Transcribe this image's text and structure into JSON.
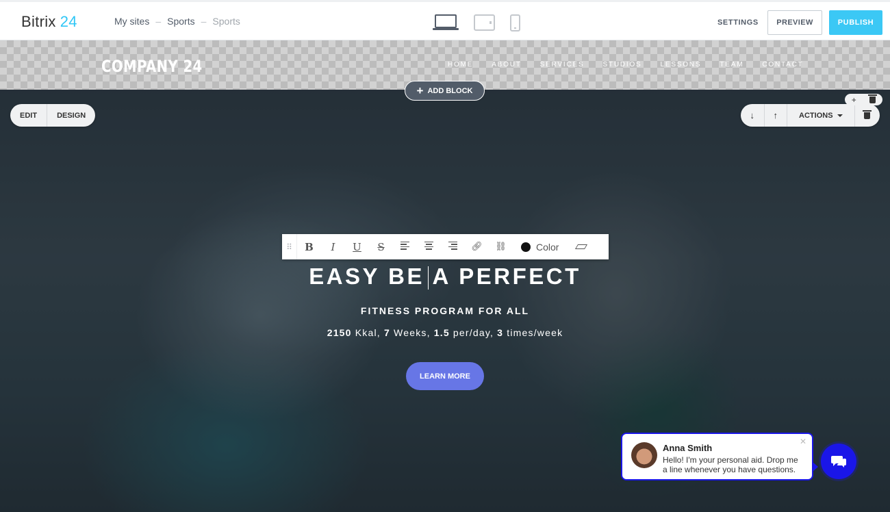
{
  "app": {
    "brand": "Bitrix",
    "brand_num": "24"
  },
  "breadcrumb": [
    "My sites",
    "Sports",
    "Sports"
  ],
  "device_icons": [
    "laptop-icon",
    "tablet-icon",
    "phone-icon"
  ],
  "toolbar": {
    "settings_label": "SETTINGS",
    "preview_label": "PREVIEW",
    "publish_label": "PUBLISH"
  },
  "site": {
    "company": "COMPANY 24",
    "nav": [
      "HOME",
      "ABOUT",
      "SERVICES",
      "STUDIOS",
      "LESSONS",
      "TEAM",
      "CONTACT"
    ]
  },
  "block": {
    "add_block_label": "ADD BLOCK",
    "edit_label": "EDIT",
    "design_label": "DESIGN",
    "actions_label": "ACTIONS"
  },
  "text_toolbar": {
    "color_label": "Color"
  },
  "hero": {
    "headline_part1": "EASY BE",
    "headline_part2": "A PERFECT",
    "subhead": "FITNESS PROGRAM FOR ALL",
    "stats": [
      {
        "value": "2150",
        "unit": " Kkal, "
      },
      {
        "value": "7",
        "unit": " Weeks, "
      },
      {
        "value": "1.5",
        "unit": " per/day, "
      },
      {
        "value": "3",
        "unit": " times/week"
      }
    ],
    "cta_label": "LEARN MORE"
  },
  "chat": {
    "name": "Anna Smith",
    "message": "Hello! I'm your personal aid. Drop me a line whenever you have questions."
  },
  "colors": {
    "accent": "#3bc8f5",
    "cta": "#6776e6",
    "chat": "#1a16e8"
  }
}
